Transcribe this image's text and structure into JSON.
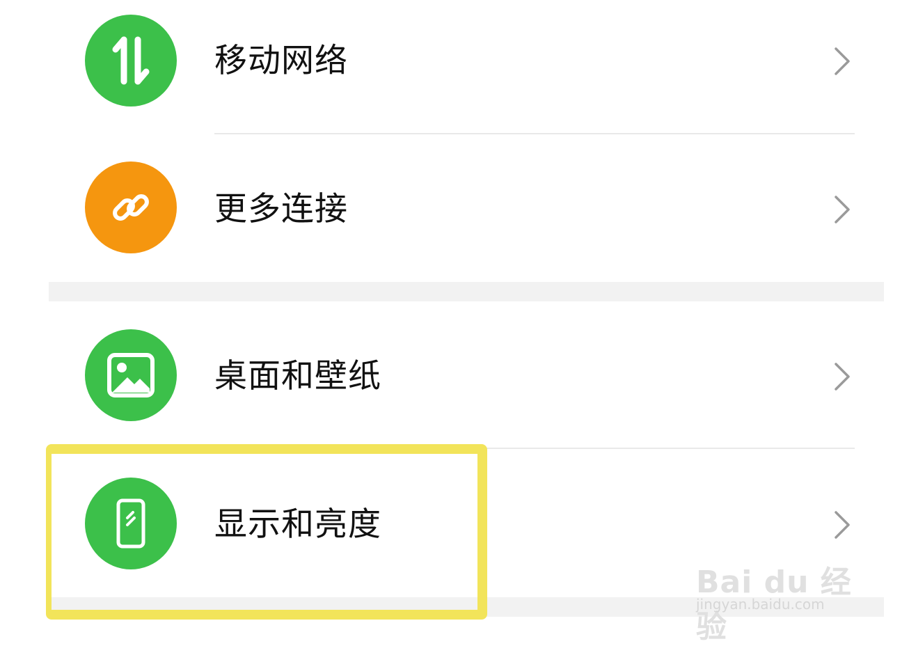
{
  "settings": {
    "items": [
      {
        "label": "移动网络",
        "icon": "mobile-data-icon",
        "color": "#3cc04a"
      },
      {
        "label": "更多连接",
        "icon": "link-icon",
        "color": "#f5960f"
      },
      {
        "label": "桌面和壁纸",
        "icon": "image-icon",
        "color": "#3cc04a"
      },
      {
        "label": "显示和亮度",
        "icon": "phone-display-icon",
        "color": "#3cc04a"
      }
    ],
    "highlight_color": "#f2e45a"
  },
  "watermark": {
    "brand": "Bai du 经验",
    "url": "jingyan.baidu.com"
  }
}
